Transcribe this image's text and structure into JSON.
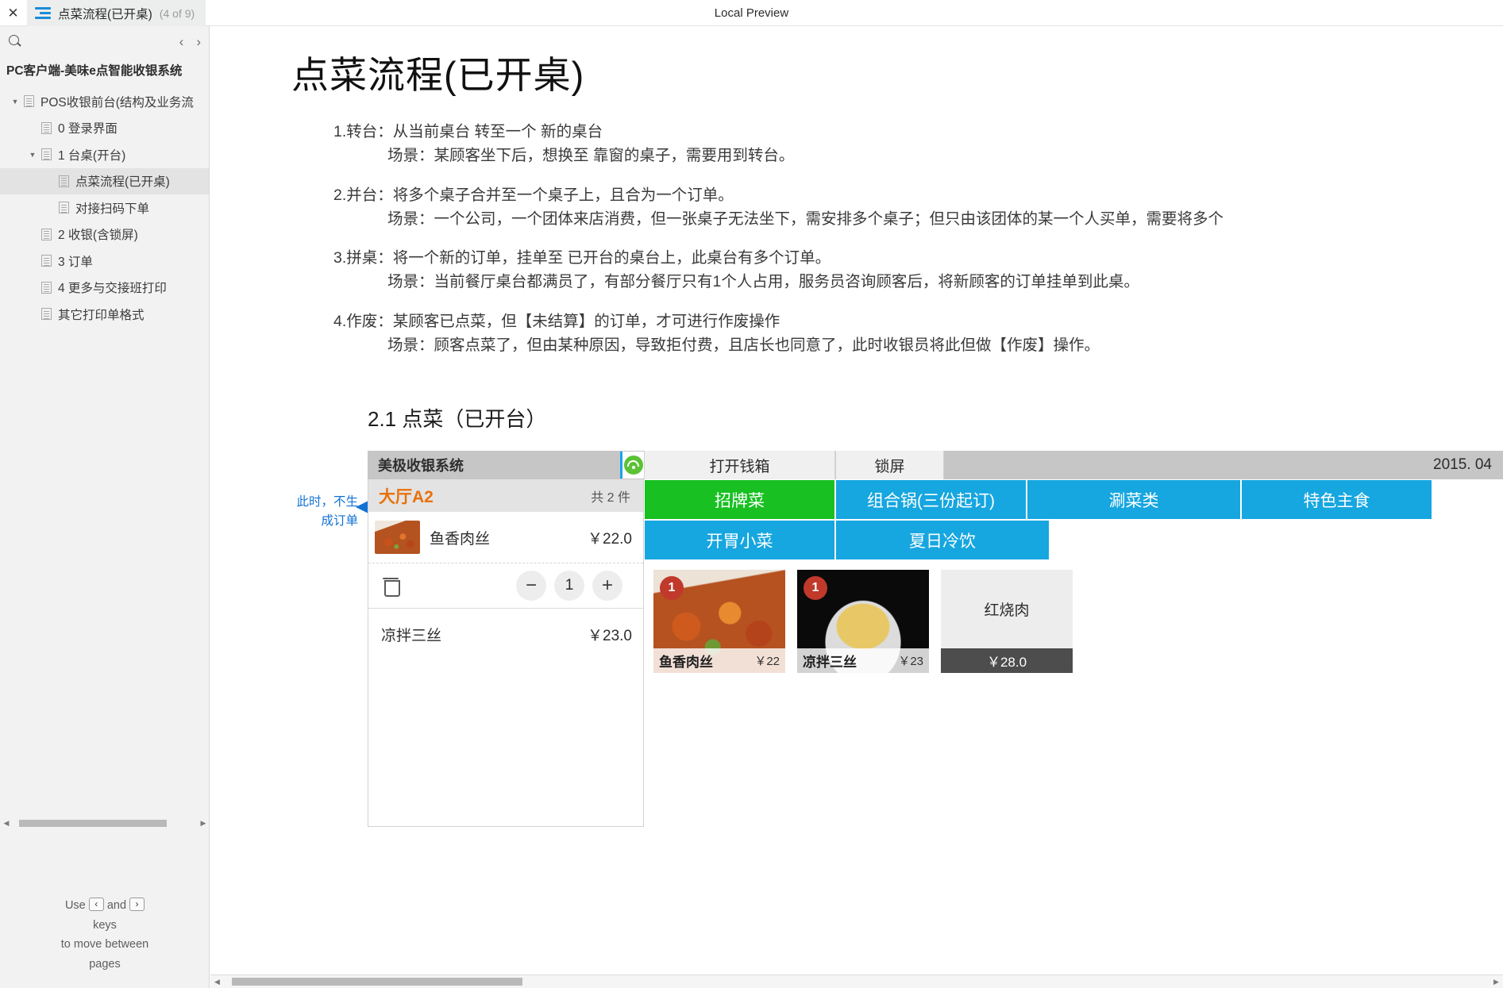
{
  "window": {
    "close_label": "✕",
    "tab_title": "点菜流程(已开桌)",
    "tab_count": "(4 of 9)",
    "preview_label": "Local Preview"
  },
  "sidebar": {
    "prev_label": "‹",
    "next_label": "›",
    "project_title": "PC客户端-美味e点智能收银系统",
    "tree": [
      {
        "label": "POS收银前台(结构及业务流",
        "indent": 0,
        "caret": "▼",
        "selected": false
      },
      {
        "label": "0 登录界面",
        "indent": 1,
        "caret": "",
        "selected": false
      },
      {
        "label": "1 台桌(开台)",
        "indent": 1,
        "caret": "▼",
        "selected": false
      },
      {
        "label": "点菜流程(已开桌)",
        "indent": 2,
        "caret": "",
        "selected": true
      },
      {
        "label": "对接扫码下单",
        "indent": 2,
        "caret": "",
        "selected": false
      },
      {
        "label": "2 收银(含锁屏)",
        "indent": 1,
        "caret": "",
        "selected": false
      },
      {
        "label": "3 订单",
        "indent": 1,
        "caret": "",
        "selected": false
      },
      {
        "label": "4 更多与交接班打印",
        "indent": 1,
        "caret": "",
        "selected": false
      },
      {
        "label": "其它打印单格式",
        "indent": 1,
        "caret": "",
        "selected": false
      }
    ],
    "help": {
      "use": "Use",
      "key_left": "‹",
      "and": "and",
      "key_right": "›",
      "line2": "keys",
      "line3": "to move between",
      "line4": "pages"
    }
  },
  "document": {
    "title": "点菜流程(已开桌)",
    "bullets": [
      {
        "line1": "1.转台：从当前桌台 转至一个 新的桌台",
        "line2": "场景：某顾客坐下后，想换至 靠窗的桌子，需要用到转台。"
      },
      {
        "line1": "2.并台：将多个桌子合并至一个桌子上，且合为一个订单。",
        "line2": "场景：一个公司，一个团体来店消费，但一张桌子无法坐下，需安排多个桌子；但只由该团体的某一个人买单，需要将多个"
      },
      {
        "line1": "3.拼桌：将一个新的订单，挂单至 已开台的桌台上，此桌台有多个订单。",
        "line2": "场景：当前餐厅桌台都满员了，有部分餐厅只有1个人占用，服务员咨询顾客后，将新顾客的订单挂单到此桌。"
      },
      {
        "line1": "4.作废：某顾客已点菜，但【未结算】的订单，才可进行作废操作",
        "line2": "场景：顾客点菜了，但由某种原因，导致拒付费，且店长也同意了，此时收银员将此但做【作废】操作。"
      }
    ],
    "section_title": "2.1 点菜（已开台）",
    "annotation": "此时，不生\n成订单",
    "annotation_line1": "此时，不生",
    "annotation_line2": "成订单"
  },
  "pos": {
    "brand": "美极收银系统",
    "wifi_icon": "wifi-icon",
    "buttons": [
      {
        "label": "打开钱箱"
      },
      {
        "label": "锁屏"
      }
    ],
    "datetime": "2015. 04",
    "order": {
      "table_name": "大厅A2",
      "count_label": "共 2 件",
      "items": [
        {
          "name": "鱼香肉丝",
          "price": "￥22.0",
          "has_thumb": true
        },
        {
          "name": "凉拌三丝",
          "price": "￥23.0",
          "has_thumb": false
        }
      ],
      "stepper": {
        "minus": "−",
        "value": "1",
        "plus": "+",
        "delete_icon": "trash-icon"
      }
    },
    "categories": [
      {
        "label": "招牌菜",
        "color": "#18c022"
      },
      {
        "label": "组合锅(三份起订)",
        "color": "#16a6e0"
      },
      {
        "label": "涮菜类",
        "color": "#16a6e0"
      },
      {
        "label": "特色主食",
        "color": "#16a6e0"
      },
      {
        "label": "开胃小菜",
        "color": "#16a6e0"
      },
      {
        "label": "夏日冷饮",
        "color": "#16a6e0"
      }
    ],
    "dishes": [
      {
        "name": "鱼香肉丝",
        "price": "￥22",
        "badge": "1",
        "style": "photo-a"
      },
      {
        "name": "凉拌三丝",
        "price": "￥23",
        "badge": "1",
        "style": "photo-b"
      },
      {
        "name": "红烧肉",
        "price": "￥28.0",
        "badge": "",
        "style": "plain"
      }
    ]
  },
  "scroll": {
    "left_arrow": "◀",
    "right_arrow": "▶"
  }
}
